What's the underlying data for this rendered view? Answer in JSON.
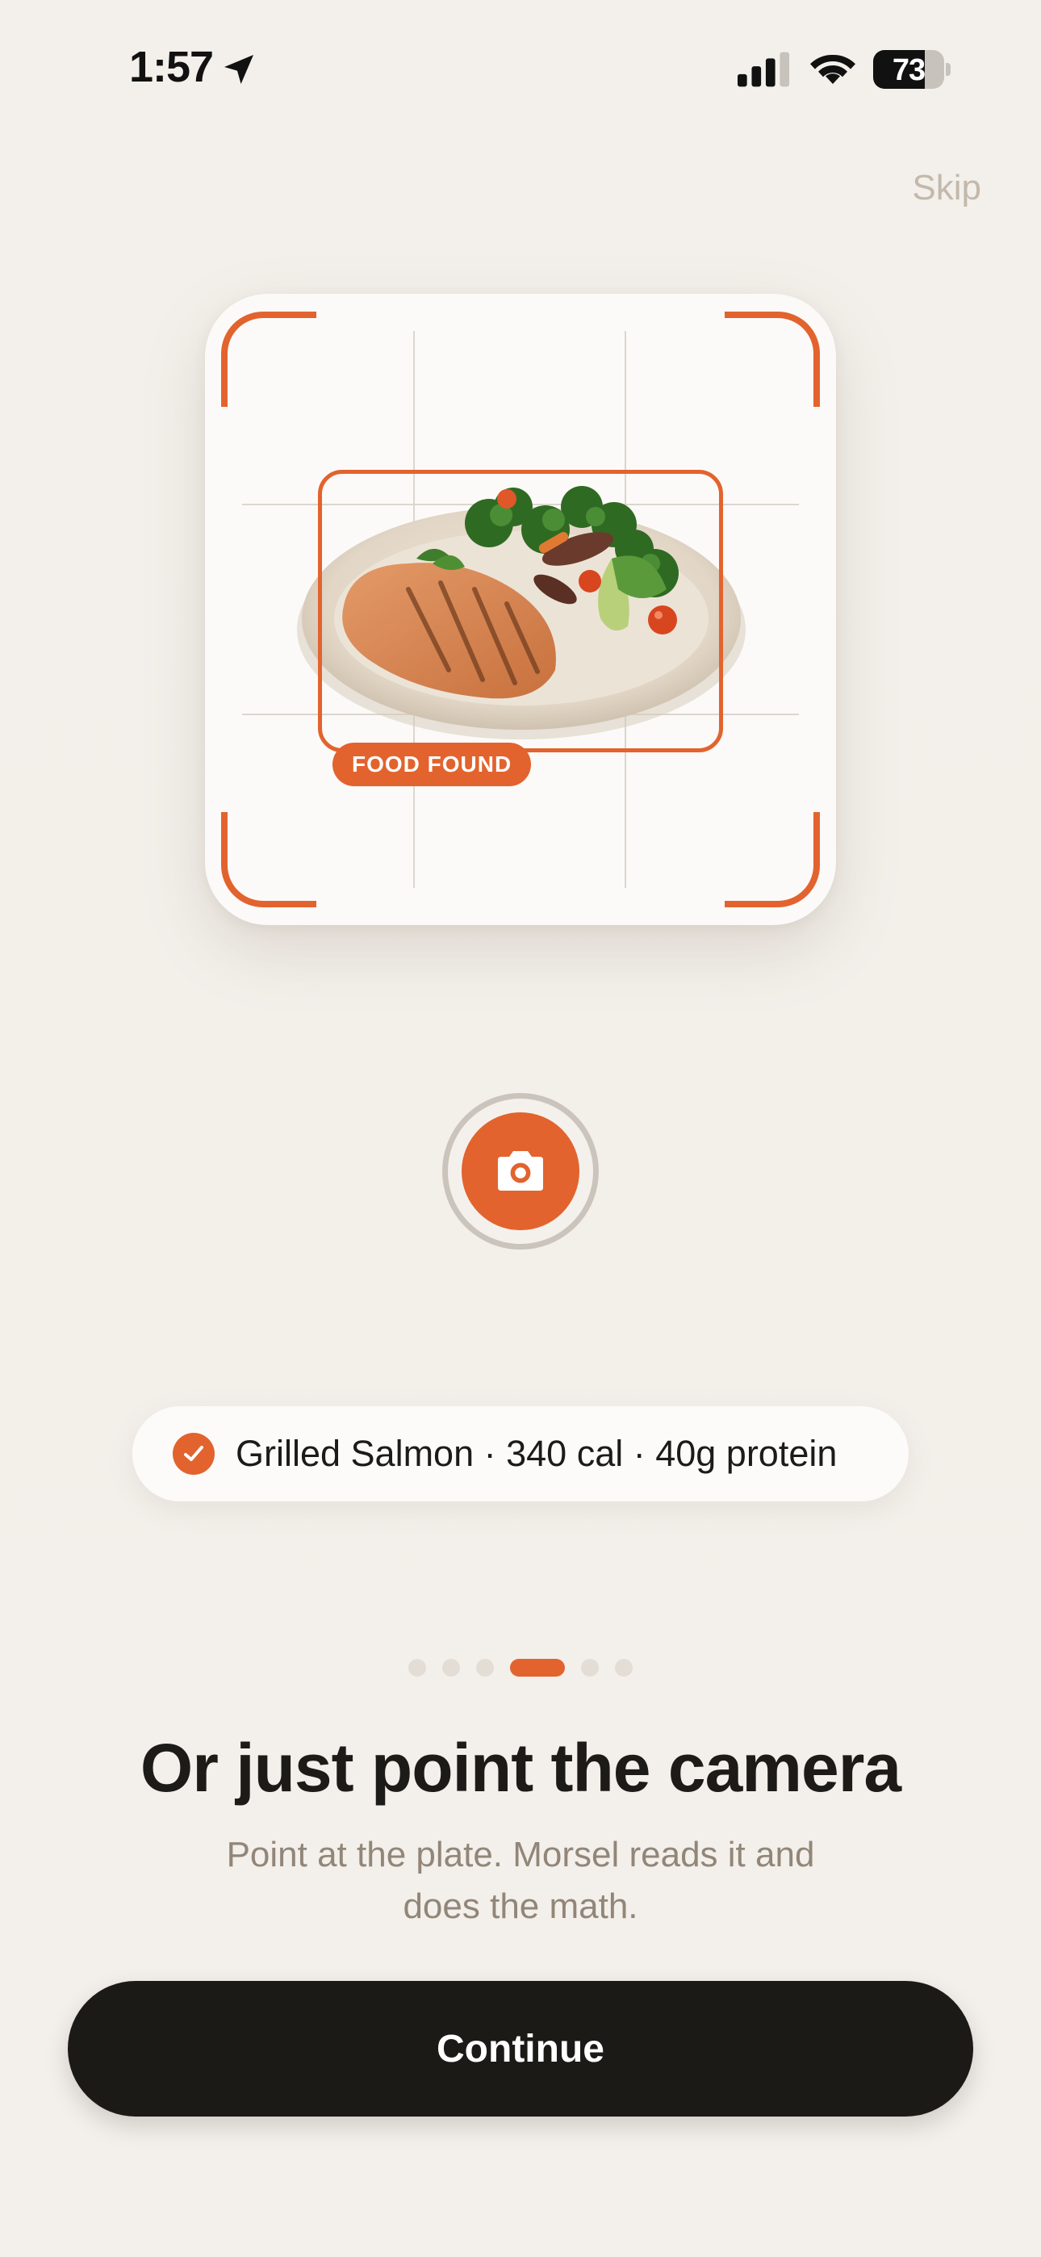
{
  "status_bar": {
    "time": "1:57",
    "battery_level": "73",
    "battery_fraction": 0.73
  },
  "header": {
    "skip_label": "Skip"
  },
  "scanner": {
    "tag_label": "FOOD FOUND",
    "accent_color": "#e2632e"
  },
  "result": {
    "text": "Grilled Salmon · 340 cal · 40g protein"
  },
  "pager": {
    "count": 6,
    "active_index": 3
  },
  "content": {
    "title": "Or just point the camera",
    "subtitle": "Point at the plate. Morsel reads it and does the math."
  },
  "footer": {
    "continue_label": "Continue"
  },
  "icons": {
    "location": "location-arrow-icon",
    "signal": "cellular-signal-icon",
    "wifi": "wifi-icon",
    "battery": "battery-icon",
    "camera": "camera-icon",
    "check": "check-icon"
  }
}
